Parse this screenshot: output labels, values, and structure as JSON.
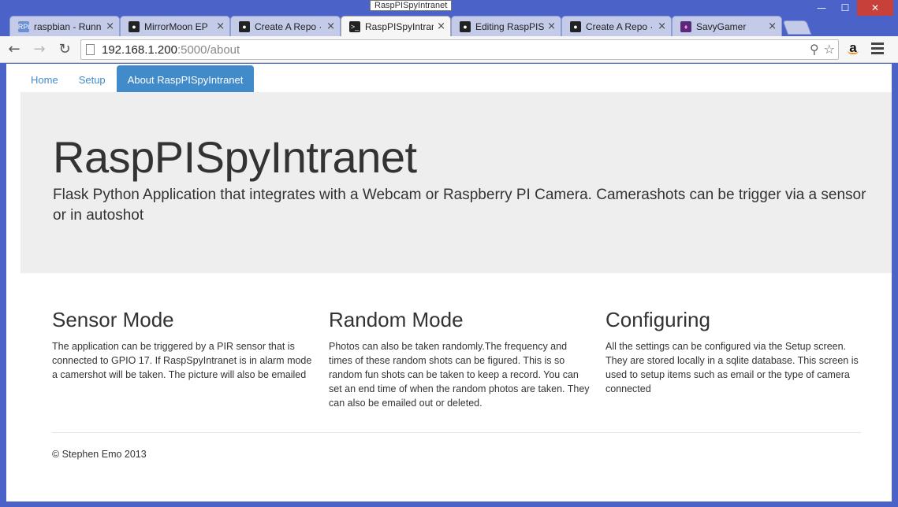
{
  "tooltip": "RaspPISpyIntranet",
  "tabs": [
    {
      "title": "raspbian - Runn",
      "icon": "raspberry-pi-icon"
    },
    {
      "title": "MirrorMoon EP",
      "icon": "mirrormoon-icon"
    },
    {
      "title": "Create A Repo ·",
      "icon": "github-icon"
    },
    {
      "title": "RaspPISpyIntran",
      "icon": "terminal-icon"
    },
    {
      "title": "Editing RaspPISp",
      "icon": "github-icon"
    },
    {
      "title": "Create A Repo ·",
      "icon": "github-icon"
    },
    {
      "title": "SavyGamer",
      "icon": "savygamer-icon"
    }
  ],
  "address": {
    "host": "192.168.1.200",
    "path": ":5000/about"
  },
  "nav": {
    "home": "Home",
    "setup": "Setup",
    "about": "About RaspPISpyIntranet"
  },
  "jumbotron": {
    "title": "RaspPISpyIntranet",
    "lead": "Flask Python Application that integrates with a Webcam or Raspberry PI Camera. Camerashots can be trigger via a sensor or in autoshot"
  },
  "columns": [
    {
      "heading": "Sensor Mode",
      "body": "The application can be triggered by a PIR sensor that is connected to GPIO 17. If RaspSpyIntranet is in alarm mode a camershot will be taken. The picture will also be emailed"
    },
    {
      "heading": "Random Mode",
      "body": "Photos can also be taken randomly.The frequency and times of these random shots can be figured. This is so random fun shots can be taken to keep a record. You can set an end time of when the random photos are taken. They can also be emailed out or deleted."
    },
    {
      "heading": "Configuring",
      "body": "All the settings can be configured via the Setup screen. They are stored locally in a sqlite database. This screen is used to setup items such as email or the type of camera connected"
    }
  ],
  "footer": "© Stephen Emo 2013",
  "colors": {
    "chrome": "#4b63c8",
    "accent": "#428bca",
    "jumbotron": "#eeeeee"
  }
}
